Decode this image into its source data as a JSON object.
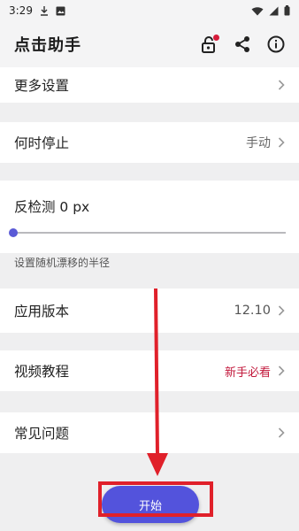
{
  "status_bar": {
    "time": "3:29",
    "icons": [
      "download-icon",
      "photo-icon",
      "wifi-icon",
      "signal-icon",
      "battery-icon"
    ]
  },
  "app_bar": {
    "title": "点击助手",
    "actions": [
      "lock-icon",
      "share-icon",
      "info-icon"
    ],
    "notification_dot_color": "#d51b3a"
  },
  "settings": {
    "more_settings": {
      "label": "更多设置"
    },
    "stop_when": {
      "label": "何时停止",
      "value": "手动"
    },
    "reverse_detect": {
      "label": "反检测 0 px",
      "hint": "设置随机漂移的半径",
      "slider_value": 0
    },
    "app_version": {
      "label": "应用版本",
      "value": "12.10"
    },
    "video_tutorial": {
      "label": "视频教程",
      "value": "新手必看",
      "value_color": "#c2183b"
    },
    "faq": {
      "label": "常见问题"
    }
  },
  "start_button": {
    "label": "开始",
    "color": "#5353dc"
  },
  "annotation": {
    "color": "#e0202a"
  }
}
